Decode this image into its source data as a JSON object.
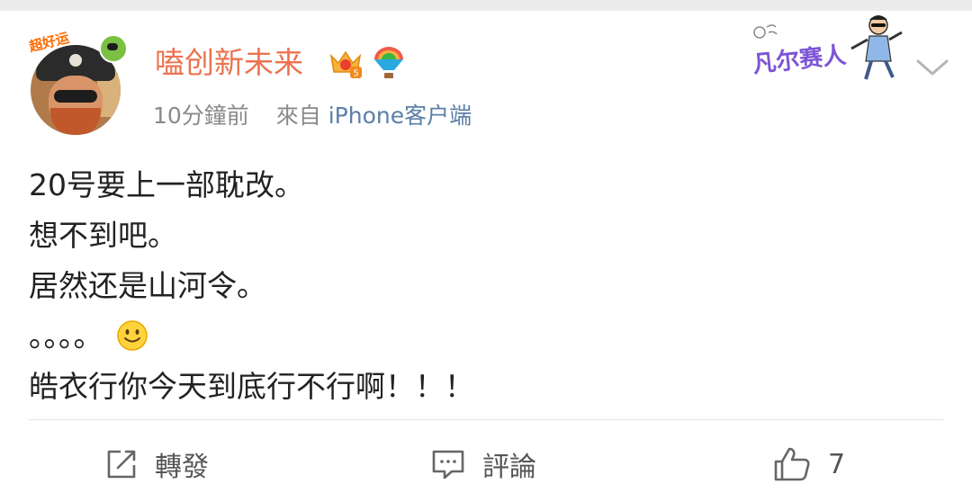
{
  "post": {
    "username": "嗑创新未来",
    "time": "10分鐘前",
    "source_prefix": "來自",
    "source": "iPhone客户端",
    "avatar_sticker": "超好运",
    "card_badge": "凡尔赛人",
    "lines": [
      "20号要上一部耽改。",
      "想不到吧。",
      "居然还是山河令。",
      "。。。。",
      "皓衣行你今天到底行不行啊！！！"
    ]
  },
  "actions": {
    "repost_label": "轉發",
    "comment_label": "評論",
    "like_count": "7"
  },
  "icons": {
    "crown": "vip-crown-icon",
    "rainbow": "rainbow-hot-air-balloon-icon",
    "expand": "chevron-down-icon",
    "smile": "smile-emoji-icon",
    "repost": "repost-icon",
    "comment": "comment-icon",
    "like": "thumbs-up-icon"
  },
  "colors": {
    "username": "#eb7350",
    "meta": "#8a8a8a",
    "source": "#5b7fa8",
    "text": "#222222",
    "badge": "#7d54d6"
  }
}
